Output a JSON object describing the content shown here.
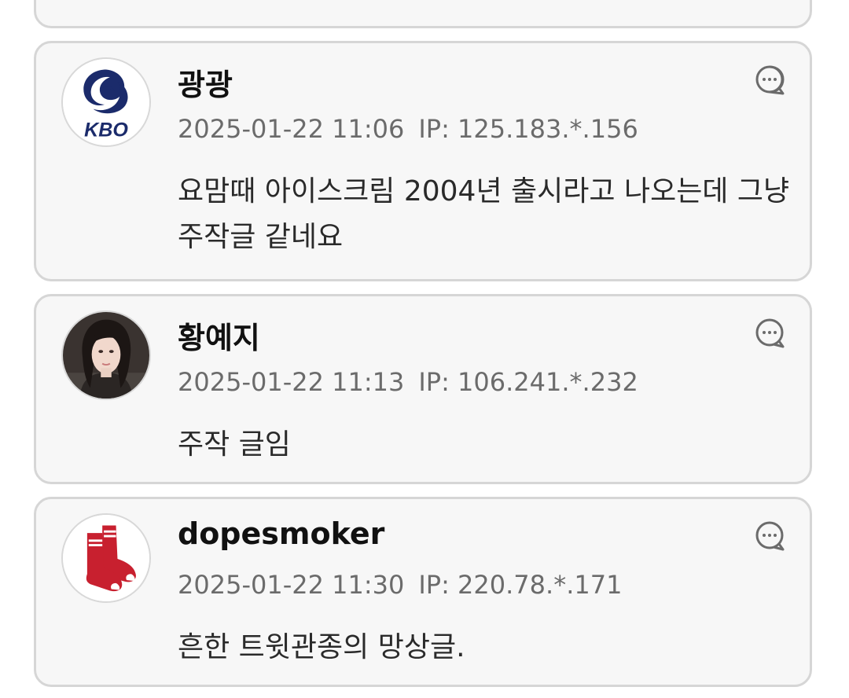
{
  "comments": [
    {
      "avatar": "kbo-logo",
      "name": "광광",
      "date": "2025-01-22 11:06",
      "ip": "IP: 125.183.*.156",
      "text": "요맘때 아이스크림 2004년 출시라고 나오는데 그냥 주작글 같네요",
      "reply_icon": "reply-bubble-icon"
    },
    {
      "avatar": "user-photo",
      "name": "황예지",
      "date": "2025-01-22 11:13",
      "ip": "IP: 106.241.*.232",
      "text": "주작 글임",
      "reply_icon": "reply-bubble-icon"
    },
    {
      "avatar": "red-socks-logo",
      "name": "dopesmoker",
      "date": "2025-01-22 11:30",
      "ip": "IP: 220.78.*.171",
      "text": "흔한 트윗관종의 망상글.",
      "reply_icon": "reply-bubble-icon"
    }
  ],
  "colors": {
    "card_bg": "#f7f7f7",
    "card_border": "#d6d6d6",
    "kbo_navy": "#1b2b6b",
    "sox_red": "#c8202f"
  }
}
